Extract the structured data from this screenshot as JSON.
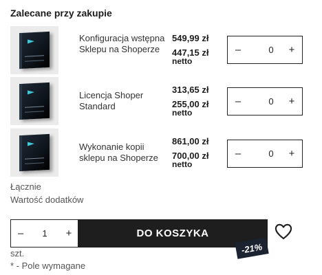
{
  "section": {
    "title": "Zalecane przy zakupie"
  },
  "products": [
    {
      "name": "Konfiguracja wstępna Sklepu na Shoperze",
      "price_gross": "549,99 zł",
      "price_net": "447,15 zł",
      "net_label": "netto",
      "qty": "0"
    },
    {
      "name": "Licencja Shoper Standard",
      "price_gross": "313,65 zł",
      "price_net": "255,00 zł",
      "net_label": "netto",
      "qty": "0"
    },
    {
      "name": "Wykonanie kopii sklepu na Shoperze",
      "price_gross": "861,00 zł",
      "price_net": "700,00 zł",
      "net_label": "netto",
      "qty": "0"
    }
  ],
  "stepper": {
    "minus": "–",
    "plus": "+"
  },
  "summary": {
    "total_label": "Łącznie",
    "addons_label": "Wartość dodatków"
  },
  "purchase": {
    "qty": "1",
    "cart_label": "DO KOSZYKA",
    "discount_badge": "-21%",
    "unit": "szt.",
    "required_note": "* - Pole wymagane"
  },
  "icons": {
    "favorite": "heart-icon",
    "product_box": "product-box-icon"
  }
}
